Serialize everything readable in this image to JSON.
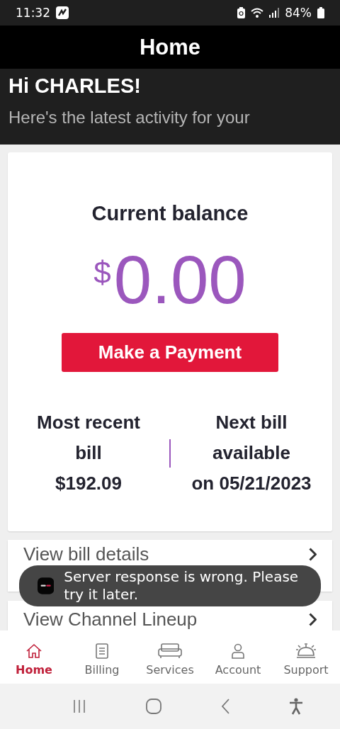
{
  "status_bar": {
    "time": "11:32",
    "battery": "84%"
  },
  "header": {
    "title": "Home"
  },
  "greeting": {
    "title": "Hi CHARLES!",
    "subtitle": "Here's the latest activity for your"
  },
  "balance": {
    "title": "Current balance",
    "currency": "$",
    "amount": "0.00",
    "button": "Make a Payment",
    "recent": {
      "label": "Most recent bill",
      "value": "$192.09"
    },
    "next": {
      "label": "Next bill available",
      "value": "on 05/21/2023"
    }
  },
  "links": [
    {
      "label": "View bill details"
    },
    {
      "label": "View Channel Lineup"
    }
  ],
  "toast": {
    "message": "Server response is wrong. Please try it later."
  },
  "nav": [
    {
      "label": "Home",
      "selected": true
    },
    {
      "label": "Billing",
      "selected": false
    },
    {
      "label": "Services",
      "selected": false
    },
    {
      "label": "Account",
      "selected": false
    },
    {
      "label": "Support",
      "selected": false
    }
  ]
}
